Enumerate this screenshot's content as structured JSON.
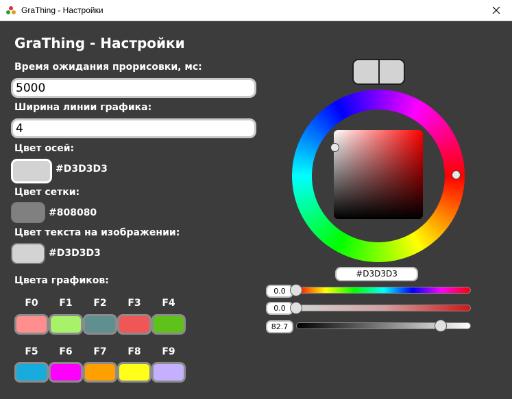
{
  "window": {
    "title": "GraThing - Настройки"
  },
  "heading": "GraThing - Настройки",
  "render_timeout": {
    "label": "Время ожидания прорисовки, мс:",
    "value": "5000"
  },
  "line_width": {
    "label": "Ширина линии графика:",
    "value": "4"
  },
  "axes_color": {
    "label": "Цвет осей:",
    "hex": "#D3D3D3"
  },
  "grid_color": {
    "label": "Цвет сетки:",
    "hex": "#808080"
  },
  "text_color": {
    "label": "Цвет текста на изображении:",
    "hex": "#D3D3D3"
  },
  "graph_colors": {
    "label": "Цвета графиков:",
    "items": [
      {
        "name": "F0",
        "color": "#ff8f8f"
      },
      {
        "name": "F1",
        "color": "#a8f26a"
      },
      {
        "name": "F2",
        "color": "#5f8f8f"
      },
      {
        "name": "F3",
        "color": "#ef5656"
      },
      {
        "name": "F4",
        "color": "#5ec21a"
      },
      {
        "name": "F5",
        "color": "#18acde"
      },
      {
        "name": "F6",
        "color": "#ff00ff"
      },
      {
        "name": "F7",
        "color": "#ffa000"
      },
      {
        "name": "F8",
        "color": "#ffff1a"
      },
      {
        "name": "F9",
        "color": "#c4b0ff"
      }
    ]
  },
  "picker": {
    "hex": "#D3D3D3",
    "hue": "0.0",
    "saturation": "0.0",
    "value": "82.7",
    "value_fraction": 0.827
  }
}
